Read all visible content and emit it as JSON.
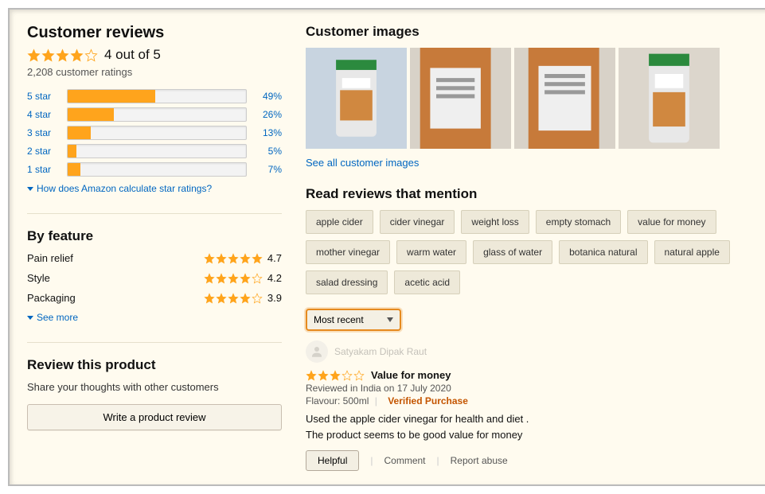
{
  "left": {
    "heading": "Customer reviews",
    "overall_stars": 4,
    "overall_text": "4 out of 5",
    "ratings_count": "2,208 customer ratings",
    "histogram": [
      {
        "label": "5 star",
        "pct": 49
      },
      {
        "label": "4 star",
        "pct": 26
      },
      {
        "label": "3 star",
        "pct": 13
      },
      {
        "label": "2 star",
        "pct": 5
      },
      {
        "label": "1 star",
        "pct": 7
      }
    ],
    "calc_link": "How does Amazon calculate star ratings?",
    "by_feature_heading": "By feature",
    "features": [
      {
        "name": "Pain relief",
        "stars": 5,
        "score": "4.7"
      },
      {
        "name": "Style",
        "stars": 4,
        "score": "4.2"
      },
      {
        "name": "Packaging",
        "stars": 4,
        "score": "3.9"
      }
    ],
    "see_more": "See more",
    "review_this_heading": "Review this product",
    "review_cta": "Share your thoughts with other customers",
    "write_btn": "Write a product review"
  },
  "right": {
    "images_heading": "Customer images",
    "see_all_images": "See all customer images",
    "mentions_heading": "Read reviews that mention",
    "tags": [
      "apple cider",
      "cider vinegar",
      "weight loss",
      "empty stomach",
      "value for money",
      "mother vinegar",
      "warm water",
      "glass of water",
      "botanica natural",
      "natural apple",
      "salad dressing",
      "acetic acid"
    ],
    "sort_selected": "Most recent",
    "review": {
      "reviewer": "Satyakam Dipak Raut",
      "stars": 3,
      "title": "Value for money",
      "meta": "Reviewed in India on 17 July 2020",
      "variant_label": "Flavour: 500ml",
      "verified": "Verified Purchase",
      "body1": "Used the apple cider vinegar for health and diet .",
      "body2": "The product seems to be good value for money",
      "helpful": "Helpful",
      "comment": "Comment",
      "report": "Report abuse"
    }
  }
}
